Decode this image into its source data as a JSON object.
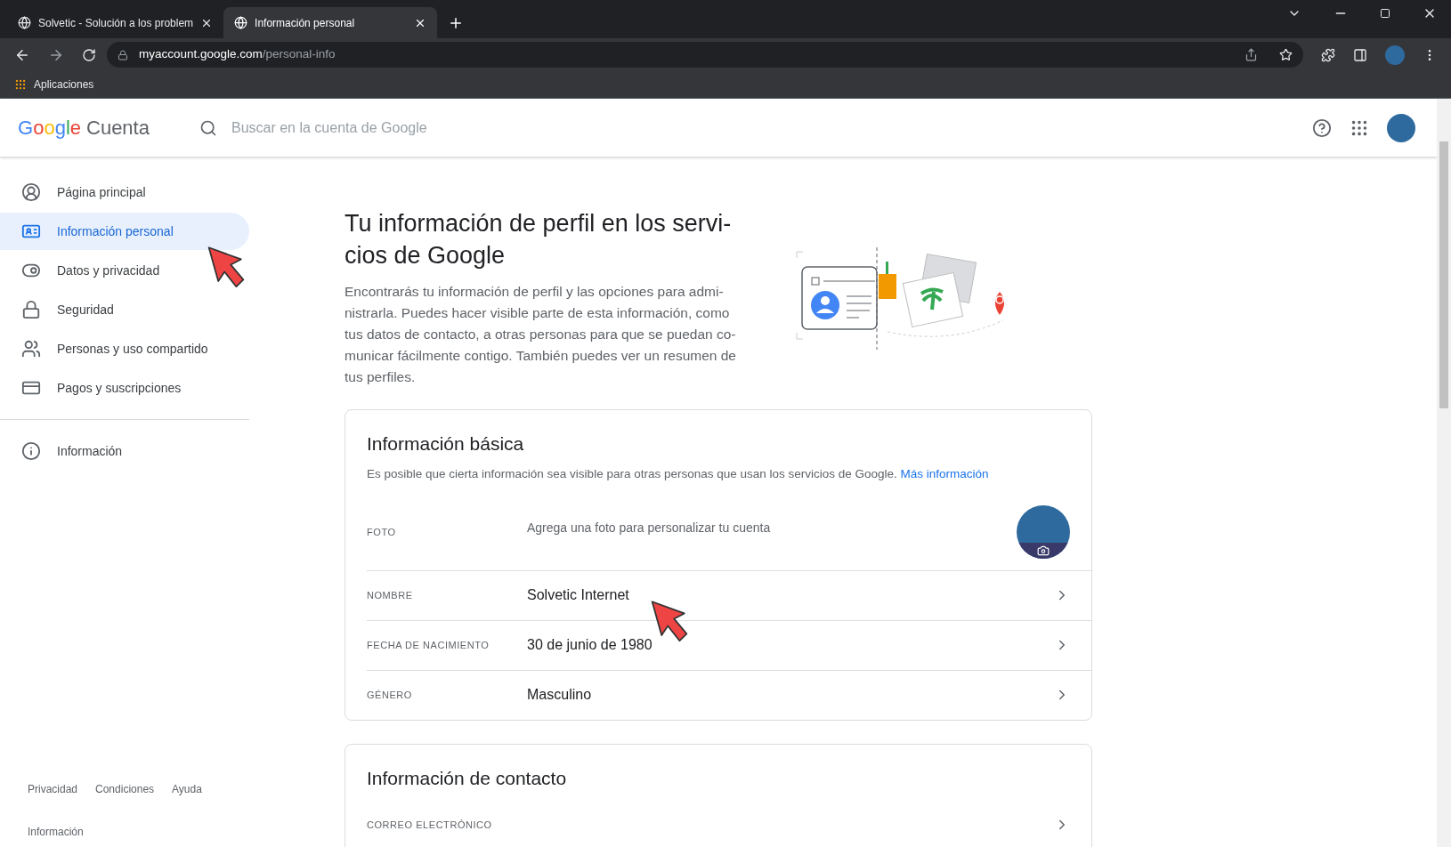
{
  "browser": {
    "tabs": [
      {
        "title": "Solvetic - Solución a los problem",
        "selected": false
      },
      {
        "title": "Información personal",
        "selected": true
      }
    ],
    "address": {
      "domain": "myaccount.google.com",
      "path": "/personal-info"
    },
    "bookmarks": [
      "Aplicaciones"
    ]
  },
  "header": {
    "brand": "Google",
    "product": "Cuenta",
    "search_placeholder": "Buscar en la cuenta de Google"
  },
  "sidebar": {
    "items": [
      {
        "kind": "home",
        "label": "Página principal",
        "selected": false
      },
      {
        "kind": "personal",
        "label": "Información personal",
        "selected": true
      },
      {
        "kind": "privacy",
        "label": "Datos y privacidad",
        "selected": false
      },
      {
        "kind": "security",
        "label": "Seguridad",
        "selected": false
      },
      {
        "kind": "people",
        "label": "Personas y uso compartido",
        "selected": false
      },
      {
        "kind": "payments",
        "label": "Pagos y suscripciones",
        "selected": false
      }
    ],
    "secondary_items": [
      {
        "kind": "info",
        "label": "Información",
        "selected": false
      }
    ],
    "footer_links": [
      "Privacidad",
      "Condiciones",
      "Ayuda"
    ],
    "footer_info": "Información"
  },
  "intro": {
    "title_lines": [
      "Tu información de perfil en los servi-",
      "cios de Google"
    ],
    "body_lines": [
      "Encontrarás tu información de perfil y las opciones para admi-",
      "nistrarla. Puedes hacer visible parte de esta información, como",
      "tus datos de contacto, a otras personas para que se puedan co-",
      "municar fácilmente contigo. También puedes ver un resumen de",
      "tus perfiles."
    ]
  },
  "basic_info": {
    "title": "Información básica",
    "description": "Es posible que cierta información sea visible para otras personas que usan los servicios de Google.",
    "link": "Más información",
    "rows": [
      {
        "kind": "photo",
        "label": "FOTO",
        "value": "Agrega una foto para personalizar tu cuenta"
      },
      {
        "kind": "field",
        "label": "NOMBRE",
        "value": "Solvetic Internet"
      },
      {
        "kind": "field",
        "label": "FECHA DE NACIMIENTO",
        "value": "30 de junio de 1980"
      },
      {
        "kind": "field",
        "label": "GÉNERO",
        "value": "Masculino"
      }
    ]
  },
  "contact_info": {
    "title": "Información de contacto",
    "rows": [
      {
        "kind": "field",
        "label": "CORREO ELECTRÓNICO"
      }
    ]
  }
}
